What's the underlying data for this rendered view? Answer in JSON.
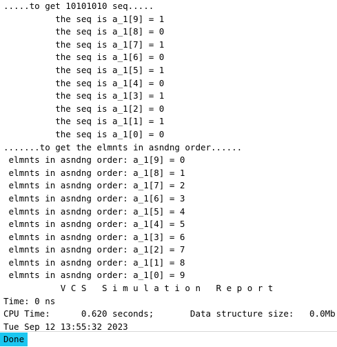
{
  "console": {
    "lines": [
      ".....to get 10101010 seq.....",
      "          the seq is a_1[9] = 1",
      "          the seq is a_1[8] = 0",
      "          the seq is a_1[7] = 1",
      "          the seq is a_1[6] = 0",
      "          the seq is a_1[5] = 1",
      "          the seq is a_1[4] = 0",
      "          the seq is a_1[3] = 1",
      "          the seq is a_1[2] = 0",
      "          the seq is a_1[1] = 1",
      "          the seq is a_1[0] = 0",
      ".......to get the elmnts in asndng order......",
      " elmnts in asndng order: a_1[9] = 0",
      " elmnts in asndng order: a_1[8] = 1",
      " elmnts in asndng order: a_1[7] = 2",
      " elmnts in asndng order: a_1[6] = 3",
      " elmnts in asndng order: a_1[5] = 4",
      " elmnts in asndng order: a_1[4] = 5",
      " elmnts in asndng order: a_1[3] = 6",
      " elmnts in asndng order: a_1[2] = 7",
      " elmnts in asndng order: a_1[1] = 8",
      " elmnts in asndng order: a_1[0] = 9",
      "           V C S   S i m u l a t i o n   R e p o r t",
      "Time: 0 ns",
      "CPU Time:      0.620 seconds;       Data structure size:   0.0Mb",
      "Tue Sep 12 13:55:32 2023"
    ]
  },
  "status": {
    "label": "Done",
    "color": "#1cc6f0"
  }
}
